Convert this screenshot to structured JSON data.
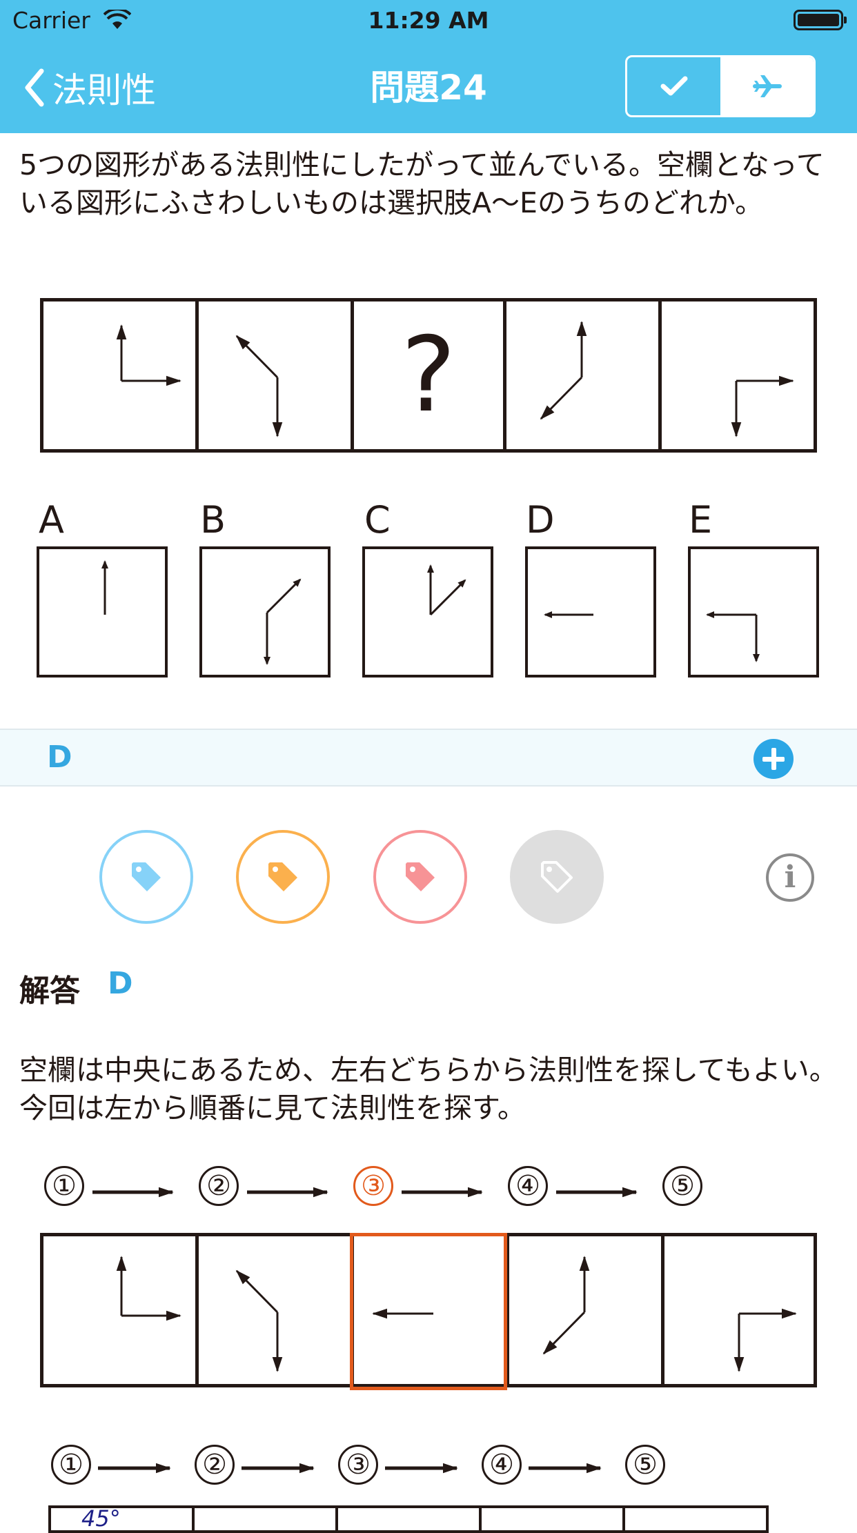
{
  "status_bar": {
    "carrier": "Carrier",
    "time": "11:29 AM"
  },
  "nav": {
    "back_label": "法則性",
    "title": "問題24",
    "segment": {
      "left_icon": "checkmark-icon",
      "right_icon": "airplane-icon",
      "selected": "right"
    }
  },
  "question": {
    "text": "5つの図形がある法則性にしたがって並んでいる。空欄となっている図形にふさわしいものは選択肢A〜Eのうちのどれか。"
  },
  "figure": {
    "question_mark": "?"
  },
  "options": {
    "labels": [
      "A",
      "B",
      "C",
      "D",
      "E"
    ]
  },
  "answer_bar": {
    "value": "D"
  },
  "tags": {
    "colors": [
      "#86d2f8",
      "#fbb04d",
      "#f79396",
      "#dedede"
    ],
    "icons": [
      "tag-icon-blue",
      "tag-icon-orange",
      "tag-icon-red",
      "tag-icon-gray"
    ]
  },
  "solution": {
    "label": "解答",
    "value": "D",
    "text": "空欄は中央にあるため、左右どちらから法則性を探してもよい。今回は左から順番に見て法則性を探す。"
  },
  "steps_row_1": {
    "numbers": [
      "①",
      "②",
      "③",
      "④",
      "⑤"
    ],
    "highlighted_index": 2
  },
  "steps_row_2": {
    "numbers": [
      "①",
      "②",
      "③",
      "④",
      "⑤"
    ]
  },
  "bottom_figure": {
    "angle_label": "45°"
  },
  "colors": {
    "header": "#4ec3ed",
    "accent": "#35a7e0",
    "highlight": "#e25a1c"
  }
}
